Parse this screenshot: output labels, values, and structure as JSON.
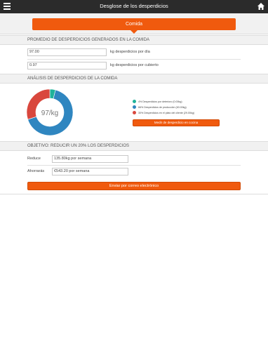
{
  "header": {
    "title": "Desglose de los desperdicios"
  },
  "segment": {
    "label": "Comida"
  },
  "promedio": {
    "heading": "PROMEDIO DE DESPERDICIOS GENERADOS EN LA COMIDA",
    "per_day_value": "97.00",
    "per_day_label": "kg desperdicios por día",
    "per_cover_value": "0.97",
    "per_cover_label": "kg desperdicios por cubierto"
  },
  "analisis": {
    "heading": "ANÁLISIS DE DESPERDICIOS DE LA COMIDA",
    "center_label": "97/kg",
    "legend": [
      {
        "text": "4% Desperdicios por deterioro (0.00kg)",
        "color": "#1fb39a"
      },
      {
        "text": "66% Desperdicios de producción (63.00kg)",
        "color": "#2f86c0"
      },
      {
        "text": "30% Desperdicios en el plato del cliente (29.00kg)",
        "color": "#d9473d"
      }
    ],
    "button_label": "Medir de desperdicio en cocina"
  },
  "chart_data": {
    "type": "pie",
    "categories": [
      "Desperdicios por deterioro",
      "Desperdicios de producción",
      "Desperdicios en el plato del cliente"
    ],
    "values": [
      4,
      66,
      30
    ],
    "colors": [
      "#1fb39a",
      "#2f86c0",
      "#d9473d"
    ],
    "center_label": "97/kg"
  },
  "objetivo": {
    "heading": "OBJETIVO: REDUCIR UN 20% LOS DESPERDICIOS",
    "reduce_label": "Reduce",
    "reduce_value": "135.80kg por semana",
    "save_label": "Ahorrarás",
    "save_value": "€543.20 por semana",
    "email_button": "Enviar por correo electrónico"
  },
  "icons": {
    "menu": "hamburger-menu-icon",
    "home": "home-icon"
  },
  "colors": {
    "accent": "#f05a0e",
    "topbar": "#2b2b2b"
  }
}
